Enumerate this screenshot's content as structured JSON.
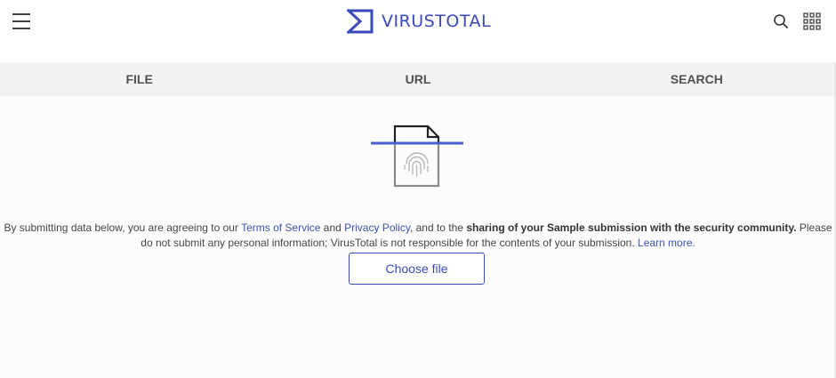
{
  "header": {
    "brand": "VIRUSTOTAL",
    "menu_icon": "hamburger-icon",
    "search_icon": "search-icon",
    "apps_icon": "grid-apps-icon"
  },
  "tabs": [
    {
      "label": "FILE"
    },
    {
      "label": "URL"
    },
    {
      "label": "SEARCH"
    }
  ],
  "consent": {
    "part1": "By submitting data below, you are agreeing to our ",
    "terms_link": "Terms of Service",
    "part2": " and ",
    "privacy_link": "Privacy Policy",
    "part3": ", and to the ",
    "bold": "sharing of your Sample submission with the security community.",
    "part4": " Please do not submit any personal information; VirusTotal is not responsible for the contents of your submission. ",
    "learn_more": "Learn more."
  },
  "upload": {
    "illustration_icon": "fingerprint-file-scan-icon",
    "button_label": "Choose file"
  },
  "colors": {
    "brand": "#3b49b8",
    "link": "#3b52b0",
    "tab_bar": "#f3f3f4"
  }
}
